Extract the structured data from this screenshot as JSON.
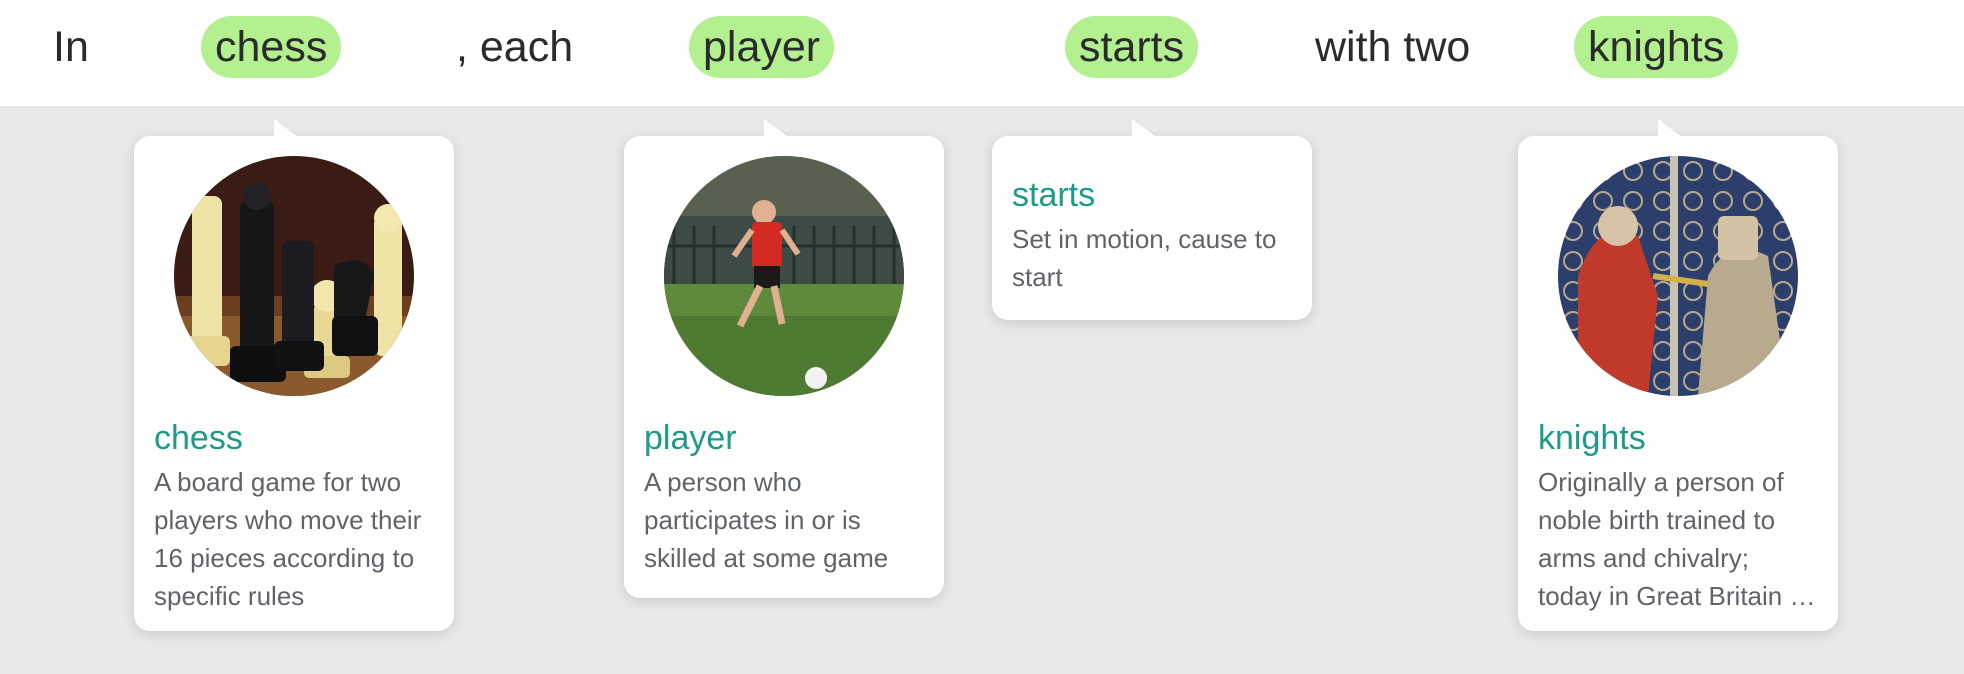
{
  "sentence": {
    "w1": "In",
    "w2": "chess",
    "w3": ", each",
    "w4": "player",
    "w5": "starts",
    "w6": "with two",
    "w7": "knights"
  },
  "cards": [
    {
      "title": "chess",
      "description": "A board game for two players who move their 16 pieces according to specific rules",
      "image": "chess-pieces-image"
    },
    {
      "title": "player",
      "description": "A person who participates in or is skilled at some game",
      "image": "soccer-player-image"
    },
    {
      "title": "starts",
      "description": "Set in motion, cause to start"
    },
    {
      "title": "knights",
      "description": "Originally a person of noble birth trained to arms and chivalry; today in Great Britain a person honored by the sovereign",
      "image": "medieval-knights-illustration"
    }
  ],
  "colors": {
    "highlight": "#b3f08f",
    "title": "#1c9b88",
    "background": "#e8e8e8"
  }
}
